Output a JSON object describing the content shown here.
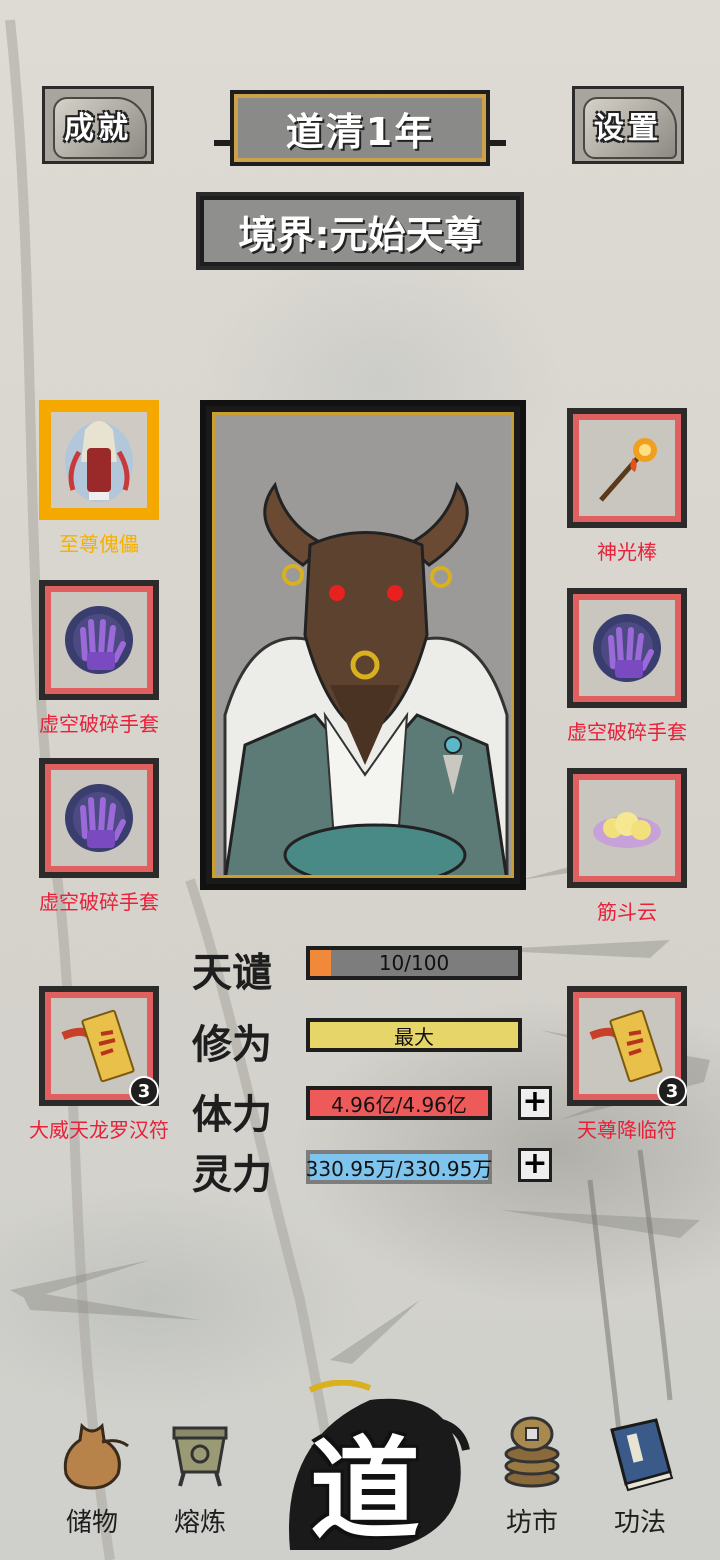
{
  "header": {
    "achievements_label": "成就",
    "settings_label": "设置",
    "year_label": "道清1年",
    "realm_label": "境界:元始天尊"
  },
  "equipment": {
    "left": [
      {
        "name": "至尊傀儡",
        "rarity": "gold"
      },
      {
        "name": "虚空破碎手套",
        "rarity": "red"
      },
      {
        "name": "虚空破碎手套",
        "rarity": "red"
      },
      {
        "name": "大威天龙罗汉符",
        "rarity": "red",
        "count": "3"
      }
    ],
    "right": [
      {
        "name": "神光棒",
        "rarity": "red"
      },
      {
        "name": "虚空破碎手套",
        "rarity": "red"
      },
      {
        "name": "筋斗云",
        "rarity": "red"
      },
      {
        "name": "天尊降临符",
        "rarity": "red",
        "count": "3"
      }
    ]
  },
  "stats": {
    "tribulation": {
      "label": "天谴",
      "value": "10/100",
      "fraction": 0.1,
      "color": "#f08a3a"
    },
    "cultivation": {
      "label": "修为",
      "value": "最大",
      "fraction": 1.0,
      "color": "#e6d66a"
    },
    "stamina": {
      "label": "体力",
      "value": "4.96亿/4.96亿",
      "fraction": 1.0,
      "color": "#ee5a5a"
    },
    "spirit": {
      "label": "灵力",
      "value": "330.95万/330.95万",
      "fraction": 1.0,
      "color": "#7ec4ec"
    },
    "plus_symbol": "+"
  },
  "nav": {
    "storage": "储物",
    "smelt": "熔炼",
    "dao": "道",
    "market": "坊市",
    "techniques": "功法"
  },
  "colors": {
    "rare_red": "#e8203a",
    "legend_gold": "#f5a800"
  }
}
